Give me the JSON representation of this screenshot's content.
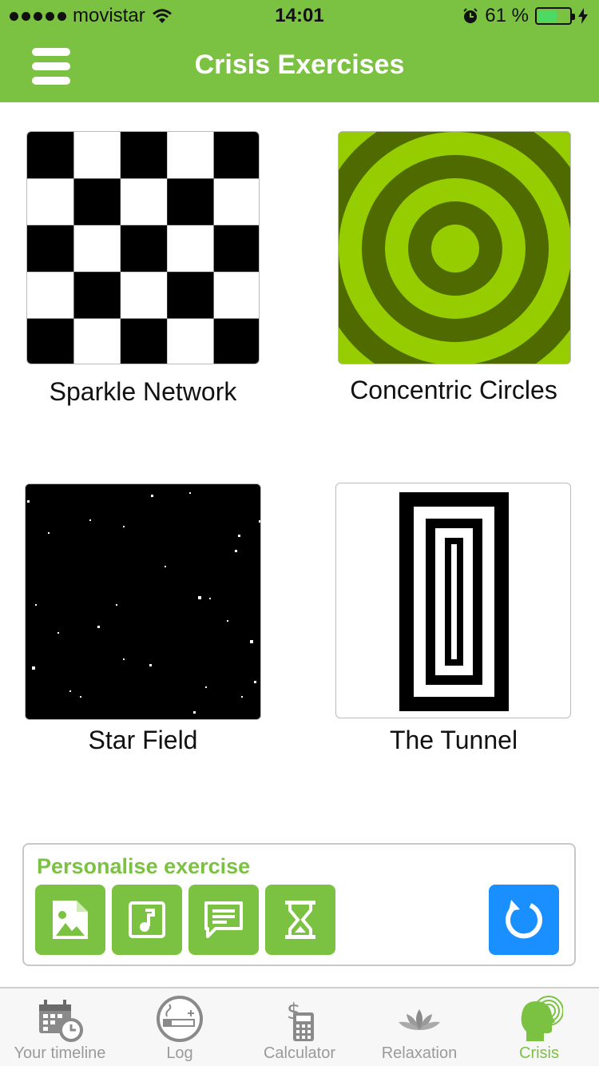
{
  "status_bar": {
    "carrier": "movistar",
    "time": "14:01",
    "battery_percent": "61 %",
    "battery_level": 0.61,
    "signal_bars": 5
  },
  "header": {
    "title": "Crisis Exercises",
    "background_color": "#7cc242",
    "menu_icon": "hamburger-menu-icon"
  },
  "exercises": [
    {
      "label": "Sparkle Network",
      "thumbnail": "checkerboard-pattern"
    },
    {
      "label": "Concentric Circles",
      "thumbnail": "concentric-circles-pattern"
    },
    {
      "label": "Star Field",
      "thumbnail": "star-field-pattern"
    },
    {
      "label": "The Tunnel",
      "thumbnail": "tunnel-rectangles-pattern"
    }
  ],
  "personalise": {
    "title": "Personalise exercise",
    "buttons": [
      {
        "icon": "image-icon"
      },
      {
        "icon": "music-note-icon"
      },
      {
        "icon": "message-icon"
      },
      {
        "icon": "hourglass-icon"
      }
    ],
    "reset_icon": "refresh-icon",
    "accent_color": "#7cc242",
    "reset_color": "#1a8fff"
  },
  "tabs": [
    {
      "label": "Your timeline",
      "icon": "calendar-clock-icon",
      "active": false
    },
    {
      "label": "Log",
      "icon": "cigarette-icon",
      "active": false
    },
    {
      "label": "Calculator",
      "icon": "money-calculator-icon",
      "active": false
    },
    {
      "label": "Relaxation",
      "icon": "lotus-icon",
      "active": false
    },
    {
      "label": "Crisis",
      "icon": "head-waves-icon",
      "active": true
    }
  ]
}
